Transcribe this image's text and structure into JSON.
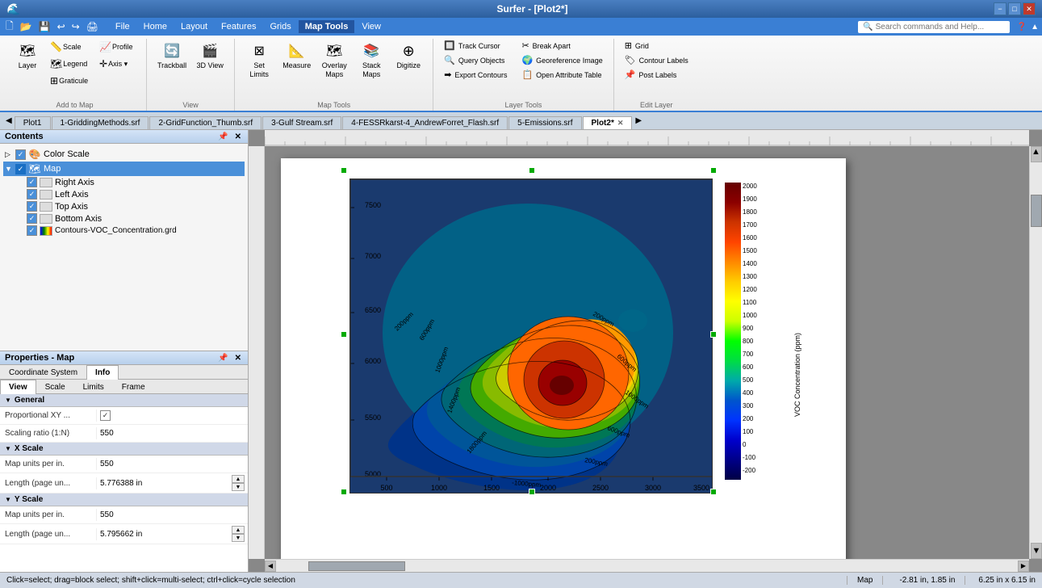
{
  "titlebar": {
    "title": "Surfer - [Plot2*]",
    "minimize": "−",
    "maximize": "□",
    "close": "✕"
  },
  "menubar": {
    "items": [
      "File",
      "Home",
      "Layout",
      "Features",
      "Grids",
      "Map Tools",
      "View"
    ],
    "active": "Map Tools",
    "search_placeholder": "Search commands and Help..."
  },
  "quickaccess": {
    "icons": [
      "🗋",
      "📂",
      "💾",
      "↩",
      "↪",
      "🖨"
    ]
  },
  "ribbon": {
    "groups": [
      {
        "label": "Add to Map",
        "buttons": [
          {
            "icon": "🗺",
            "label": "Layer",
            "large": true
          },
          {
            "icon": "📏",
            "label": "Scale",
            "large": false
          },
          {
            "icon": "🗺",
            "label": "Legend",
            "large": false
          },
          {
            "icon": "⊞",
            "label": "Graticule",
            "large": false
          },
          {
            "icon": "👤",
            "label": "Profile",
            "large": false
          },
          {
            "icon": "✛",
            "label": "Axis",
            "large": false
          }
        ]
      },
      {
        "label": "View",
        "buttons": [
          {
            "icon": "🔄",
            "label": "Trackball",
            "large": true
          },
          {
            "icon": "🎬",
            "label": "3D View",
            "large": true
          }
        ]
      },
      {
        "label": "Map Tools",
        "buttons": [
          {
            "icon": "⊠",
            "label": "Set Limits",
            "large": true
          },
          {
            "icon": "📐",
            "label": "Measure",
            "large": true
          },
          {
            "icon": "🗺",
            "label": "Overlay Maps",
            "large": true
          },
          {
            "icon": "🗺",
            "label": "Stack Maps",
            "large": true
          },
          {
            "icon": "✛",
            "label": "Digitize",
            "large": true
          }
        ]
      },
      {
        "label": "Layer Tools",
        "small_buttons": [
          {
            "icon": "⊕",
            "label": "Break Apart"
          },
          {
            "icon": "🌍",
            "label": "Georeference Image"
          },
          {
            "icon": "📋",
            "label": "Open Attribute Table"
          },
          {
            "icon": "🔲",
            "label": "Track Cursor"
          },
          {
            "icon": "🔍",
            "label": "Query Objects"
          },
          {
            "icon": "➡",
            "label": "Export Contours"
          }
        ]
      },
      {
        "label": "Edit Layer",
        "small_buttons": [
          {
            "icon": "⊞",
            "label": "Grid"
          },
          {
            "icon": "🏷",
            "label": "Contour Labels"
          },
          {
            "icon": "📌",
            "label": "Post Labels"
          }
        ]
      }
    ]
  },
  "tabs": {
    "items": [
      {
        "label": "Plot1",
        "active": false,
        "closable": false
      },
      {
        "label": "1-GriddingMethods.srf",
        "active": false,
        "closable": false
      },
      {
        "label": "2-GridFunction_Thumb.srf",
        "active": false,
        "closable": false
      },
      {
        "label": "3-Gulf Stream.srf",
        "active": false,
        "closable": false
      },
      {
        "label": "4-FESSRkarst-4_AndrewForret_Flash.srf",
        "active": false,
        "closable": false
      },
      {
        "label": "5-Emissions.srf",
        "active": false,
        "closable": false
      },
      {
        "label": "Plot2*",
        "active": true,
        "closable": true
      }
    ]
  },
  "contents": {
    "title": "Contents",
    "items": [
      {
        "level": 0,
        "label": "Color Scale",
        "checked": true,
        "expanded": false,
        "type": "color",
        "selected": false
      },
      {
        "level": 0,
        "label": "Map",
        "checked": true,
        "expanded": true,
        "type": "map",
        "selected": true
      },
      {
        "level": 1,
        "label": "Right Axis",
        "checked": true,
        "expanded": false,
        "type": "axis",
        "selected": false
      },
      {
        "level": 1,
        "label": "Left Axis",
        "checked": true,
        "expanded": false,
        "type": "axis",
        "selected": false
      },
      {
        "level": 1,
        "label": "Top Axis",
        "checked": true,
        "expanded": false,
        "type": "axis",
        "selected": false
      },
      {
        "level": 1,
        "label": "Bottom Axis",
        "checked": true,
        "expanded": false,
        "type": "axis",
        "selected": false
      },
      {
        "level": 1,
        "label": "Contours-VOC_Concentration.grd",
        "checked": true,
        "expanded": false,
        "type": "grid",
        "selected": false
      }
    ]
  },
  "properties": {
    "title": "Properties - Map",
    "tabs": [
      "Coordinate System",
      "Info"
    ],
    "secondary_tabs": [
      "View",
      "Scale",
      "Limits",
      "Frame"
    ],
    "sections": [
      {
        "label": "General",
        "rows": [
          {
            "label": "Proportional XY ...",
            "value": "✓",
            "type": "checkbox"
          },
          {
            "label": "Scaling ratio (1:N)",
            "value": "550",
            "type": "text"
          }
        ]
      },
      {
        "label": "X Scale",
        "rows": [
          {
            "label": "Map units per in.",
            "value": "550",
            "type": "text"
          },
          {
            "label": "Length (page un...",
            "value": "5.776388 in",
            "type": "spin"
          }
        ]
      },
      {
        "label": "Y Scale",
        "rows": [
          {
            "label": "Map units per in.",
            "value": "550",
            "type": "text"
          },
          {
            "label": "Length (page un...",
            "value": "5.795662 in",
            "type": "spin"
          }
        ]
      }
    ]
  },
  "statusbar": {
    "left": "Click=select; drag=block select; shift+click=multi-select; ctrl+click=cycle selection",
    "mid": "Map",
    "right": "-2.81 in, 1.85 in",
    "size": "6.25 in x 6.15 in"
  },
  "colorscale": {
    "values": [
      2000,
      1900,
      1800,
      1700,
      1600,
      1500,
      1400,
      1300,
      1200,
      1100,
      1000,
      900,
      800,
      700,
      600,
      500,
      400,
      300,
      200,
      100,
      0,
      -100,
      -200
    ],
    "label": "VOC Concentration (ppm)",
    "colors": [
      "#8b0000",
      "#b22222",
      "#cc3300",
      "#dd4400",
      "#ee6600",
      "#ff8800",
      "#ffaa00",
      "#ffcc00",
      "#ffee00",
      "#ccdd00",
      "#88cc00",
      "#44bb00",
      "#00aa00",
      "#009933",
      "#007766",
      "#005599",
      "#0033cc",
      "#0011dd",
      "#0000bb",
      "#000099",
      "#000077",
      "#000055",
      "#000033"
    ]
  },
  "map": {
    "x_labels": [
      "500",
      "1000",
      "1500",
      "2000",
      "2500",
      "3000",
      "3500"
    ],
    "y_labels": [
      "5000",
      "5500",
      "6000",
      "6500",
      "7000",
      "7500"
    ]
  }
}
